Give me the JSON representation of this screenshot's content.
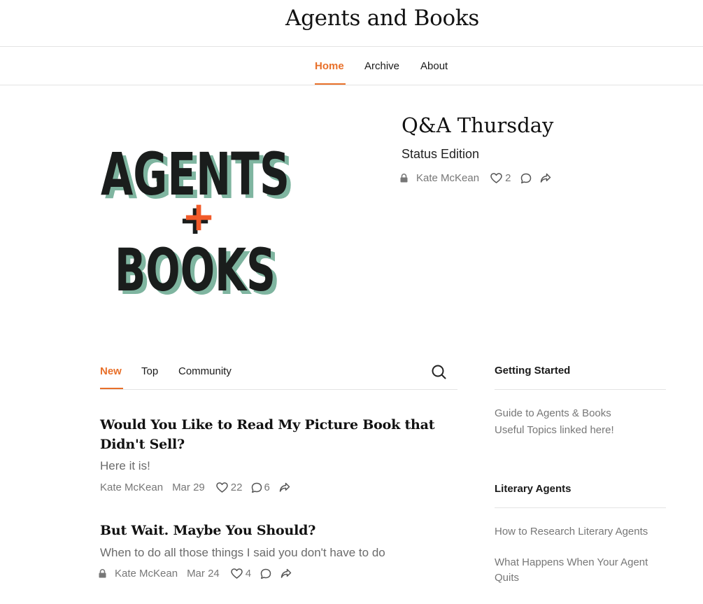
{
  "site": {
    "title": "Agents and Books"
  },
  "nav": {
    "items": [
      "Home",
      "Archive",
      "About"
    ],
    "active": "Home"
  },
  "logo": {
    "line1": "AGENTS",
    "plus": "+",
    "line2": "BOOKS",
    "colors": {
      "ink": "#1a1d1c",
      "shadow": "#7fb5a0",
      "plus": "#f15a29"
    }
  },
  "featured": {
    "title": "Q&A Thursday",
    "subtitle": "Status Edition",
    "author": "Kate McKean",
    "likes": "2",
    "locked": true
  },
  "feed": {
    "tabs": [
      "New",
      "Top",
      "Community"
    ],
    "active_tab": "New",
    "posts": [
      {
        "title": "Would You Like to Read My Picture Book that Didn't Sell?",
        "subtitle": "Here it is!",
        "author": "Kate McKean",
        "date": "Mar 29",
        "likes": "22",
        "comments": "6",
        "locked": false
      },
      {
        "title": "But Wait. Maybe You Should?",
        "subtitle": "When to do all those things I said you don't have to do",
        "author": "Kate McKean",
        "date": "Mar 24",
        "likes": "4",
        "comments": "",
        "locked": true
      }
    ]
  },
  "sidebar": {
    "sections": [
      {
        "heading": "Getting Started",
        "links": [
          "Guide to Agents & Books",
          "Useful Topics linked here!"
        ]
      },
      {
        "heading": "Literary Agents",
        "links": [
          "How to Research Literary Agents",
          "What Happens When Your Agent Quits"
        ]
      }
    ]
  },
  "colors": {
    "accent": "#e8702a",
    "muted": "#777777"
  },
  "icons": [
    "lock-icon",
    "heart-icon",
    "comment-icon",
    "share-icon",
    "search-icon"
  ]
}
